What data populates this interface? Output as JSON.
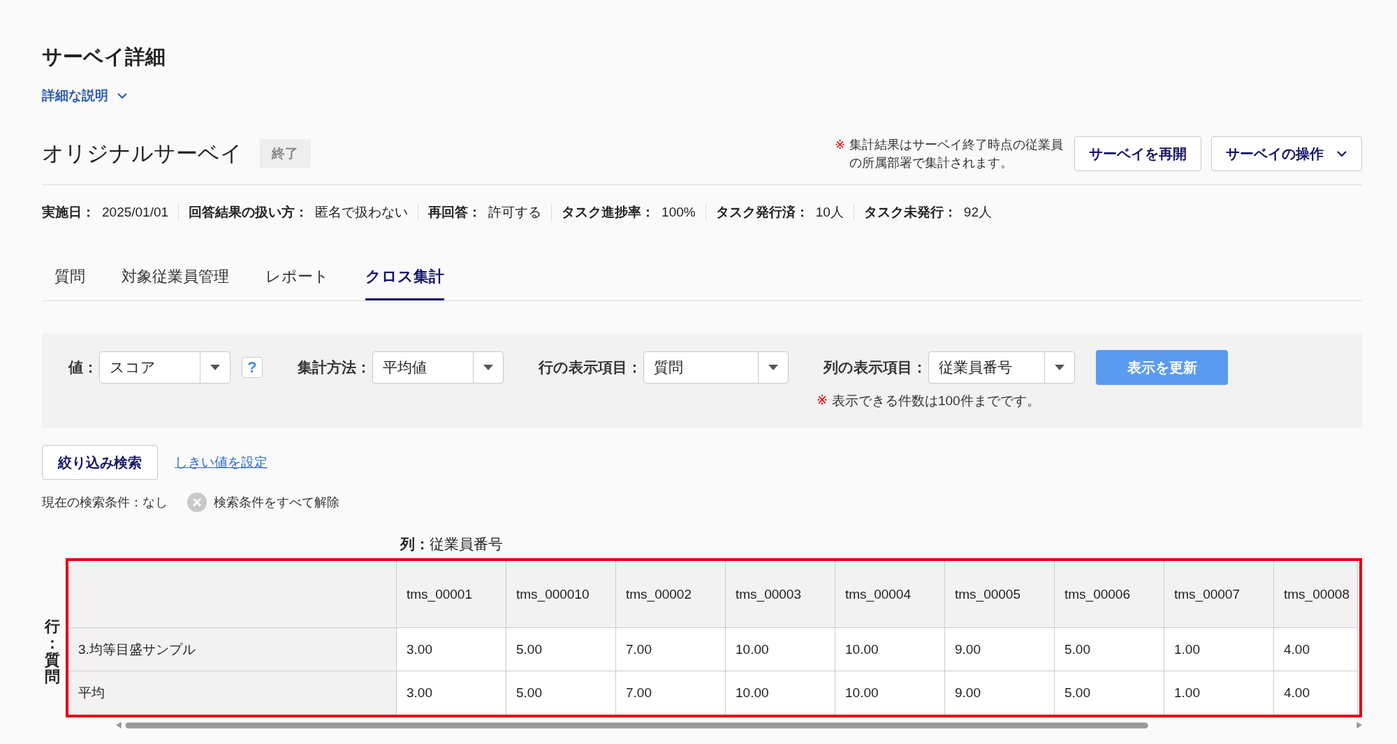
{
  "page_title": "サーベイ詳細",
  "description_toggle": {
    "label": "詳細な説明",
    "expanded": false
  },
  "survey": {
    "name": "オリジナルサーベイ",
    "status": "終了",
    "note_mark": "※",
    "note": "集計結果はサーベイ終了時点の従業員の所属部署で集計されます。",
    "buttons": [
      {
        "label": "サーベイを再開",
        "dropdown": false
      },
      {
        "label": "サーベイの操作",
        "dropdown": true
      }
    ]
  },
  "meta": [
    {
      "label": "実施日：",
      "value": "2025/01/01"
    },
    {
      "label": "回答結果の扱い方：",
      "value": "匿名で扱わない"
    },
    {
      "label": "再回答：",
      "value": "許可する"
    },
    {
      "label": "タスク進捗率：",
      "value": "100%"
    },
    {
      "label": "タスク発行済：",
      "value": "10人"
    },
    {
      "label": "タスク未発行：",
      "value": "92人"
    }
  ],
  "tabs": [
    {
      "label": "質問",
      "selected": false
    },
    {
      "label": "対象従業員管理",
      "selected": false
    },
    {
      "label": "レポート",
      "selected": false
    },
    {
      "label": "クロス集計",
      "selected": true
    }
  ],
  "filters": [
    {
      "label": "値：",
      "value": "スコア",
      "help": "?"
    },
    {
      "label": "集計方法：",
      "value": "平均値"
    },
    {
      "label": "行の表示項目：",
      "value": "質問"
    },
    {
      "label": "列の表示項目：",
      "value": "従業員番号"
    }
  ],
  "update_button": "表示を更新",
  "limit_note": {
    "mark": "※",
    "text": "表示できる件数は100件までです。"
  },
  "search_button": "絞り込み検索",
  "threshold_link": "しきい値を設定",
  "current_conditions": "現在の検索条件：なし",
  "clear_conditions": "検索条件をすべて解除",
  "table": {
    "column_axis": "**列：**従業員番号",
    "row_axis": "行：質問",
    "columns": [
      "tms_00001",
      "tms_000010",
      "tms_00002",
      "tms_00003",
      "tms_00004",
      "tms_00005",
      "tms_00006",
      "tms_00007",
      "tms_00008"
    ],
    "rows": [
      {
        "label": "3.均等目盛サンプル",
        "values": [
          "3.00",
          "5.00",
          "7.00",
          "10.00",
          "10.00",
          "9.00",
          "5.00",
          "1.00",
          "4.00"
        ]
      },
      {
        "label": "平均",
        "values": [
          "3.00",
          "5.00",
          "7.00",
          "10.00",
          "10.00",
          "9.00",
          "5.00",
          "1.00",
          "4.00"
        ]
      }
    ]
  }
}
